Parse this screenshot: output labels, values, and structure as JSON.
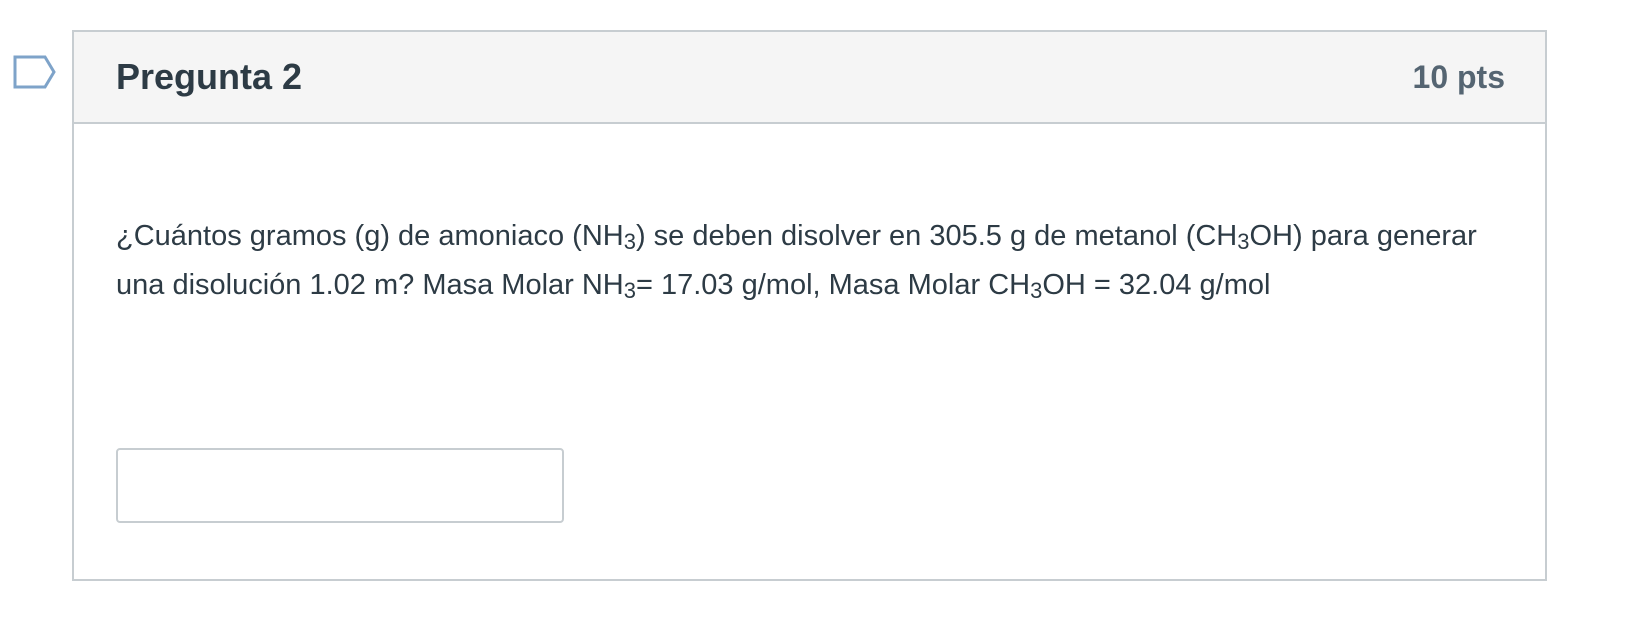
{
  "question": {
    "title": "Pregunta 2",
    "points": "10 pts",
    "text": {
      "s1": "¿Cuántos gramos (g) de amoniaco (NH",
      "sub1": "3",
      "s2": ") se deben disolver en 305.5 g de metanol (CH",
      "sub2": "3",
      "s3": "OH) para generar una disolución 1.02 m? Masa Molar NH",
      "sub3": "3",
      "s4": "= 17.03 g/mol, Masa Molar CH",
      "sub4": "3",
      "s5": "OH = 32.04 g/mol"
    },
    "answer": {
      "value": "",
      "placeholder": ""
    }
  },
  "icons": {
    "flag": "bookmark-flag-icon"
  },
  "colors": {
    "border": "#c7cdd1",
    "header_bg": "#f5f5f5",
    "text": "#2d3b45",
    "points_text": "#556572"
  }
}
